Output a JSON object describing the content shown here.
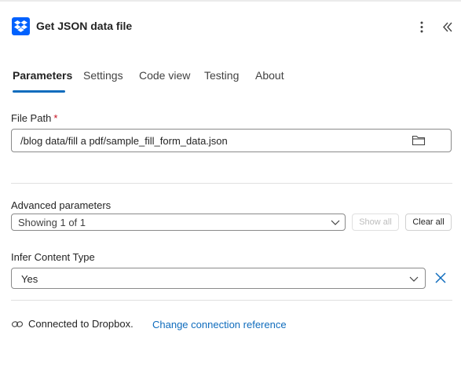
{
  "header": {
    "title": "Get JSON data file",
    "app_icon": "dropbox-icon",
    "more_icon": "more-vertical-icon",
    "collapse_icon": "double-chevron-left-icon"
  },
  "tabs": {
    "items": [
      {
        "label": "Parameters",
        "active": true
      },
      {
        "label": "Settings",
        "active": false
      },
      {
        "label": "Code view",
        "active": false
      },
      {
        "label": "Testing",
        "active": false
      },
      {
        "label": "About",
        "active": false
      }
    ]
  },
  "file_path": {
    "label": "File Path",
    "required_marker": "*",
    "value": "/blog data/fill a pdf/sample_fill_form_data.json",
    "browse_icon": "folder-icon"
  },
  "advanced": {
    "label": "Advanced parameters",
    "selected": "Showing 1 of 1",
    "show_all_label": "Show all",
    "clear_all_label": "Clear all"
  },
  "infer_content_type": {
    "label": "Infer Content Type",
    "value": "Yes",
    "remove_icon": "close-icon"
  },
  "connection": {
    "icon": "link-icon",
    "status": "Connected to Dropbox.",
    "change_link": "Change connection reference"
  },
  "colors": {
    "accent": "#0f6cbd",
    "dropbox_blue": "#0061fe",
    "required": "#c50f1f"
  }
}
